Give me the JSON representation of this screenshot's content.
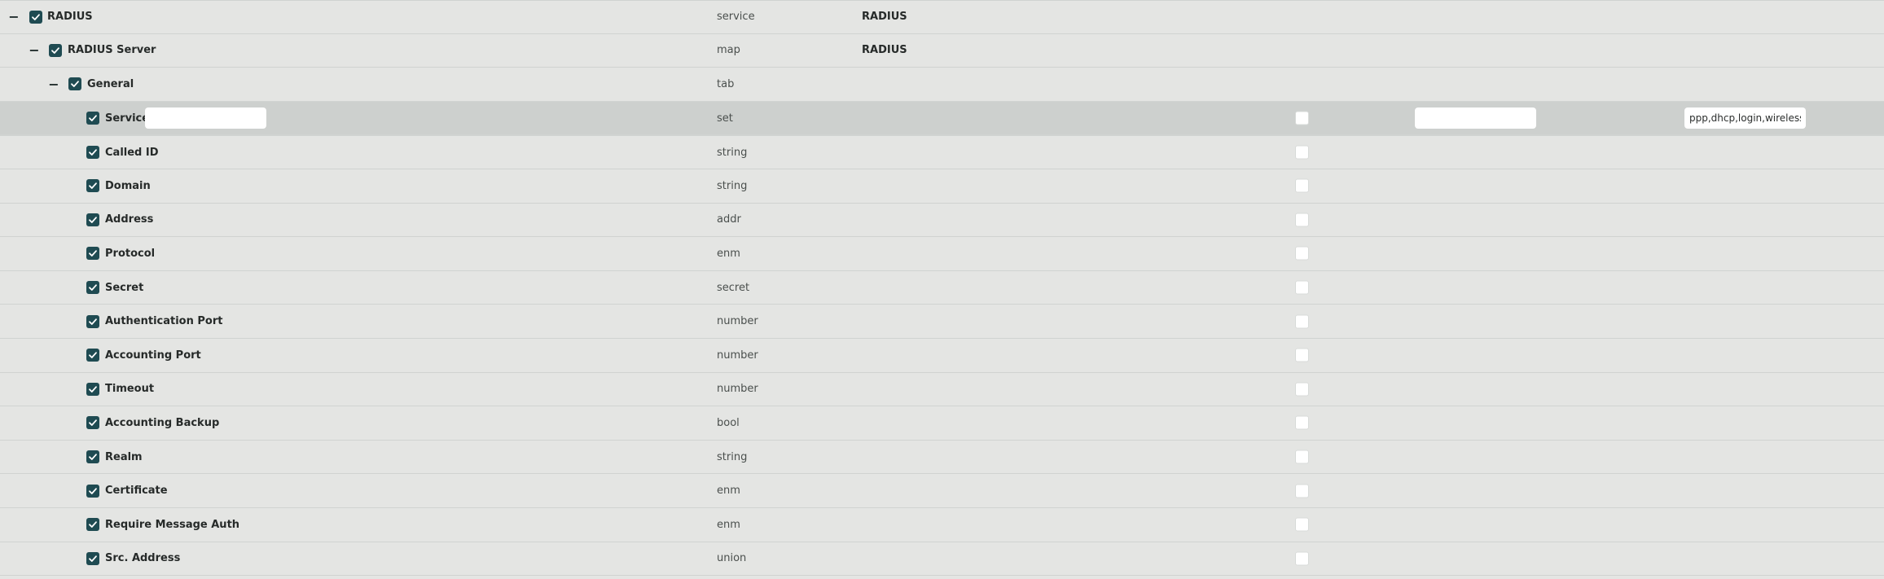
{
  "tree": {
    "radius": {
      "label": "RADIUS",
      "type": "service",
      "value": "RADIUS",
      "toggle": "−"
    },
    "radius_server": {
      "label": "RADIUS Server",
      "type": "map",
      "value": "RADIUS",
      "toggle": "−"
    },
    "general": {
      "label": "General",
      "type": "tab",
      "toggle": "−"
    },
    "service": {
      "label": "Service",
      "type": "set",
      "input_value": "",
      "default_value": "",
      "allowed_values": "ppp,dhcp,login,wireless"
    },
    "fields": [
      {
        "label": "Called ID",
        "type": "string"
      },
      {
        "label": "Domain",
        "type": "string"
      },
      {
        "label": "Address",
        "type": "addr"
      },
      {
        "label": "Protocol",
        "type": "enm"
      },
      {
        "label": "Secret",
        "type": "secret"
      },
      {
        "label": "Authentication Port",
        "type": "number"
      },
      {
        "label": "Accounting Port",
        "type": "number"
      },
      {
        "label": "Timeout",
        "type": "number"
      },
      {
        "label": "Accounting Backup",
        "type": "bool"
      },
      {
        "label": "Realm",
        "type": "string"
      },
      {
        "label": "Certificate",
        "type": "enm"
      },
      {
        "label": "Require Message Auth",
        "type": "enm"
      },
      {
        "label": "Src. Address",
        "type": "union"
      }
    ]
  },
  "colors": {
    "background": "#e4e5e3",
    "selected_row": "#cdd0ce",
    "checkbox_checked": "#1f4b52",
    "row_border": "#d0d3d1"
  }
}
